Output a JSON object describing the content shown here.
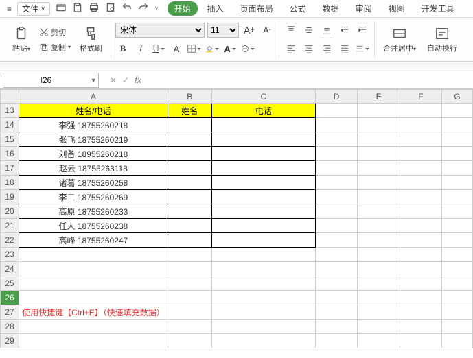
{
  "menubar": {
    "file": "文件",
    "tabs": [
      "开始",
      "插入",
      "页面布局",
      "公式",
      "数据",
      "审阅",
      "视图",
      "开发工具"
    ]
  },
  "clipboard": {
    "paste": "粘贴",
    "cut": "剪切",
    "copy": "复制",
    "painter": "格式刷"
  },
  "font": {
    "name": "宋体",
    "size": "11",
    "bold": "B",
    "italic": "I",
    "underline": "U",
    "strike": "S",
    "aplus": "A"
  },
  "align": {
    "merge": "合并居中",
    "wrap": "自动换行"
  },
  "namebox": "I26",
  "fx": "fx",
  "sheet": {
    "cols": [
      "A",
      "B",
      "C",
      "D",
      "E",
      "F",
      "G"
    ],
    "startRow": 13,
    "headers": {
      "A": "姓名/电话",
      "B": "姓名",
      "C": "电话"
    },
    "rows": [
      {
        "A": "李强 18755260218"
      },
      {
        "A": "张飞 18755260219"
      },
      {
        "A": "刘备 18955260218"
      },
      {
        "A": "赵云 18755263118"
      },
      {
        "A": "诸葛 18755260258"
      },
      {
        "A": "李二 18755260269"
      },
      {
        "A": "高原 18755260233"
      },
      {
        "A": "任人 18755260238"
      },
      {
        "A": "高峰 18755260247"
      }
    ],
    "tipRow": 27,
    "tip": "使用快捷键【Ctrl+E】（快速填充数据）",
    "lastRow": 29,
    "cursor": {
      "row": 26,
      "col": "I"
    }
  },
  "chart_data": {
    "type": "table",
    "title": "姓名/电话",
    "columns": [
      "姓名/电话",
      "姓名",
      "电话"
    ],
    "rows": [
      [
        "李强 18755260218",
        "",
        ""
      ],
      [
        "张飞 18755260219",
        "",
        ""
      ],
      [
        "刘备 18955260218",
        "",
        ""
      ],
      [
        "赵云 18755263118",
        "",
        ""
      ],
      [
        "诸葛 18755260258",
        "",
        ""
      ],
      [
        "李二 18755260269",
        "",
        ""
      ],
      [
        "高原 18755260233",
        "",
        ""
      ],
      [
        "任人 18755260238",
        "",
        ""
      ],
      [
        "高峰 18755260247",
        "",
        ""
      ]
    ]
  }
}
